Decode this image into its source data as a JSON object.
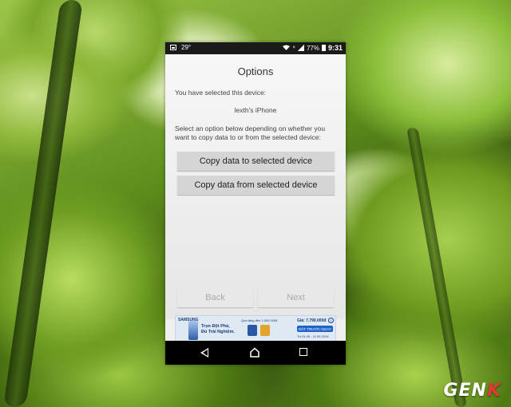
{
  "status_bar": {
    "temperature": "29°",
    "battery": "77%",
    "time": "9:31"
  },
  "screen": {
    "title": "Options",
    "selected_label": "You have selected this device:",
    "device_name": "lexth's iPhone",
    "instruction": "Select an option below depending on whether you want to copy data to or from the selected device:",
    "copy_to_button": "Copy data to selected device",
    "copy_from_button": "Copy data from selected device",
    "back_button": "Back",
    "next_button": "Next"
  },
  "ad_banner": {
    "brand": "SAMSUNG",
    "slogan_line1": "Trọn Đột Phá,",
    "slogan_line2": "Đủ Trải Nghiệm.",
    "promo": "Quà tặng đến 1.000.000đ",
    "price": "Giá: 7.790.000đ",
    "cta": "ĐẶT TRƯỚC NGAY",
    "date": "Từ 01.09 - 11.09.2019"
  },
  "watermark": {
    "text_main": "GEN",
    "text_accent": "K"
  },
  "icons": {
    "status": [
      "image-icon",
      "wifi-icon",
      "signal-icon",
      "battery-icon"
    ],
    "nav": [
      "back-icon",
      "home-icon",
      "recents-icon"
    ]
  }
}
